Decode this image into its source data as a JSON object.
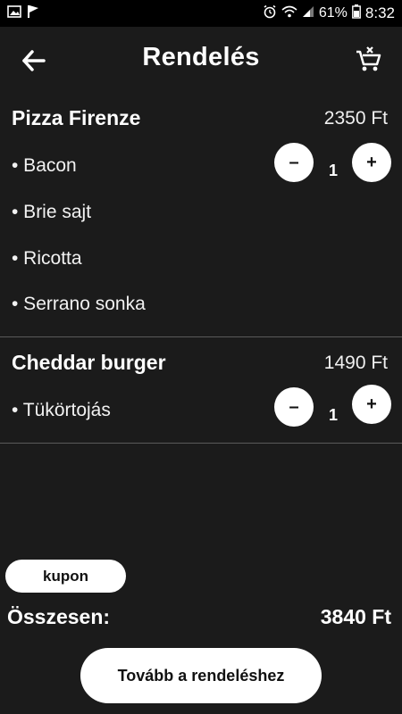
{
  "status_bar": {
    "battery": "61%",
    "time": "8:32",
    "icons": [
      "gallery-icon",
      "flag-icon",
      "alarm-icon",
      "wifi-icon",
      "signal-icon",
      "battery-icon"
    ]
  },
  "header": {
    "title": "Rendelés",
    "back_icon": "arrow-left-icon",
    "cart_icon": "cart-remove-icon"
  },
  "items": [
    {
      "name": "Pizza Firenze",
      "price": "2350 Ft",
      "options": [
        "• Bacon",
        "• Brie sajt",
        "• Ricotta",
        "• Serrano sonka"
      ],
      "quantity": "1",
      "minus": "–",
      "plus": "+"
    },
    {
      "name": "Cheddar burger",
      "price": "1490 Ft",
      "options": [
        "• Tükörtojás"
      ],
      "quantity": "1",
      "minus": "–",
      "plus": "+"
    }
  ],
  "footer": {
    "coupon_label": "kupon",
    "total_label": "Összesen:",
    "total_value": "3840 Ft",
    "continue_label": "Tovább a rendeléshez"
  },
  "colors": {
    "background": "#1b1b1b",
    "status_bar": "#000000",
    "button": "#ffffff",
    "divider": "#5a5a5a"
  }
}
